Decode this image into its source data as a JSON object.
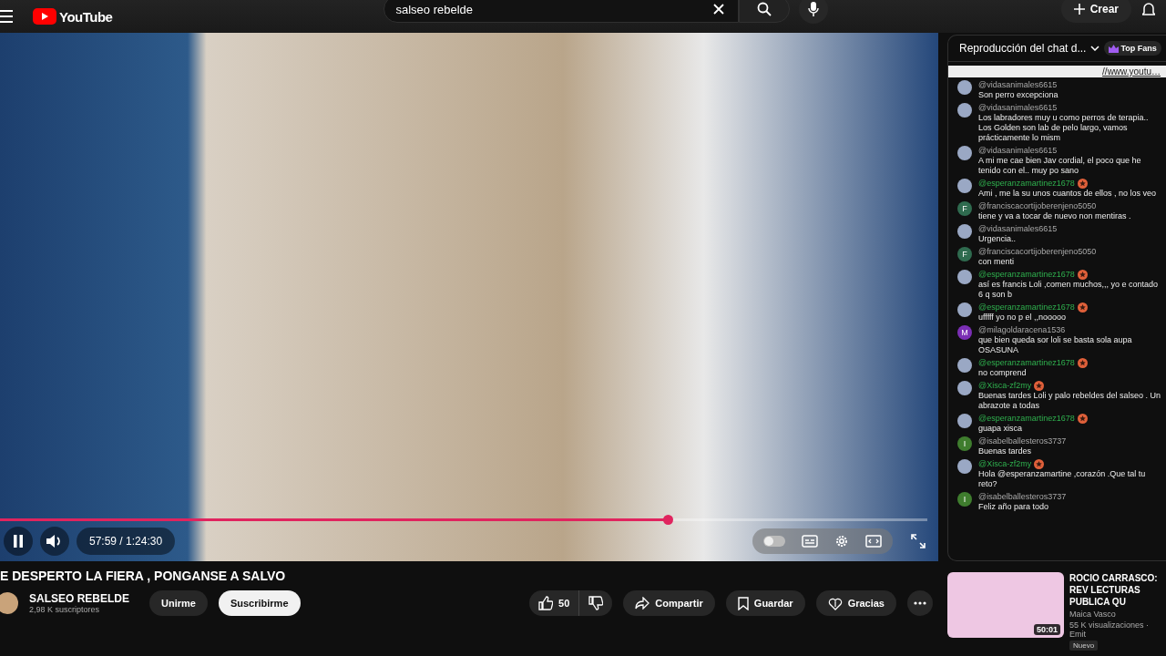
{
  "topbar": {
    "logo": "YouTube",
    "search": {
      "value": "salseo rebelde"
    },
    "create": "Crear"
  },
  "player": {
    "playing": true,
    "time": "57:59 / 1:24:30",
    "level": 0.72,
    "autoplay": false
  },
  "video": {
    "title": "E DESPERTO LA FIERA , PONGANSE A SALVO",
    "channel": "SALSEO REBELDE",
    "subscribers": "2,98 K suscriptores",
    "join": "Unirme",
    "subscribe": "Suscribirme",
    "likes": "50",
    "share": "Compartir",
    "save": "Guardar",
    "thanks": "Gracias"
  },
  "chat": {
    "title": "Reproducción del chat d...",
    "filter": "Top Fans",
    "pinned": "//www.youtu…",
    "messages": [
      {
        "author": "@vidasanimales6615",
        "text": "Son perro excepciona",
        "member": false
      },
      {
        "author": "@vidasanimales6615",
        "text": "Los labradores muy u como perros de terapia.. Los Golden son lab de pelo largo, vamos prácticamente lo mism",
        "member": false
      },
      {
        "author": "@vidasanimales6615",
        "text": "A mi me cae bien Jav cordial, el poco que he tenido con el.. muy po sano",
        "member": false
      },
      {
        "author": "@esperanzamartinez1678",
        "text": "Ami , me la su unos cuantos de ellos , no los veo",
        "member": true
      },
      {
        "author": "@franciscacortijoberenjeno5050",
        "text": "tiene y va a tocar de nuevo non mentiras .",
        "member": false,
        "letter": "F",
        "color": "#2f6b4f"
      },
      {
        "author": "@vidasanimales6615",
        "text": "Urgencia..",
        "member": false
      },
      {
        "author": "@franciscacortijoberenjeno5050",
        "text": "con menti",
        "member": false,
        "letter": "F",
        "color": "#2f6b4f"
      },
      {
        "author": "@esperanzamartinez1678",
        "text": "así es francis Loli ,comen muchos,,, yo e contado 6 q son b",
        "member": true
      },
      {
        "author": "@esperanzamartinez1678",
        "text": "ufffff yo no p el ,,nooooo",
        "member": true
      },
      {
        "author": "@milagoldaracena1536",
        "text": "que bien queda sor loli se basta sola aupa OSASUNA",
        "member": false,
        "letter": "M",
        "color": "#7b2fb5"
      },
      {
        "author": "@esperanzamartinez1678",
        "text": "no comprend",
        "member": true
      },
      {
        "author": "@Xisca-zf2my",
        "text": "Buenas tardes Loli y palo rebeldes del salseo . Un abrazote a todas",
        "member": true
      },
      {
        "author": "@esperanzamartinez1678",
        "text": "guapa xisca",
        "member": true
      },
      {
        "author": "@isabelballesteros3737",
        "text": "Buenas tardes",
        "member": false,
        "letter": "I",
        "color": "#3f7d2e"
      },
      {
        "author": "@Xisca-zf2my",
        "text": "Hola @esperanzamartine ,corazón .Que tal tu reto?",
        "member": true
      },
      {
        "author": "@isabelballesteros3737",
        "text": "Feliz año para todo",
        "member": false,
        "letter": "I",
        "color": "#3f7d2e"
      }
    ]
  },
  "recommended": {
    "title": "ROCIO CARRASCO: REV LECTURAS PUBLICA QU",
    "duration": "50:01",
    "channel": "Maica Vasco",
    "meta": "55 K visualizaciones · Emit",
    "badge": "Nuevo"
  }
}
